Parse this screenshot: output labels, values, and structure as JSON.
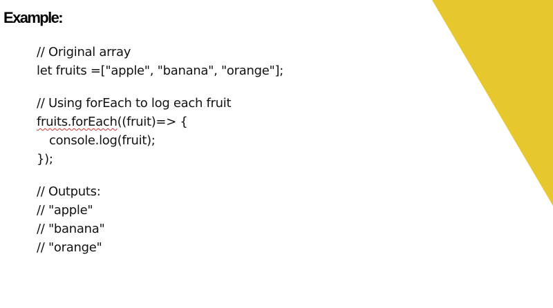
{
  "slide": {
    "title": "Example:",
    "accent_color": "#E6C72E",
    "code": {
      "comment_original": "// Original array",
      "line_let": "let fruits =[\"apple\", \"banana\", \"orange\"];",
      "comment_foreach": "// Using forEach to log each fruit",
      "foreach_call": "fruits.forEach",
      "foreach_rest": "((fruit)=> {",
      "console_line": "console.log(fruit);",
      "closing": "});",
      "comment_outputs": "// Outputs:",
      "output_apple": "// \"apple\"",
      "output_banana": "// \"banana\"",
      "output_orange": "// \"orange\""
    }
  }
}
